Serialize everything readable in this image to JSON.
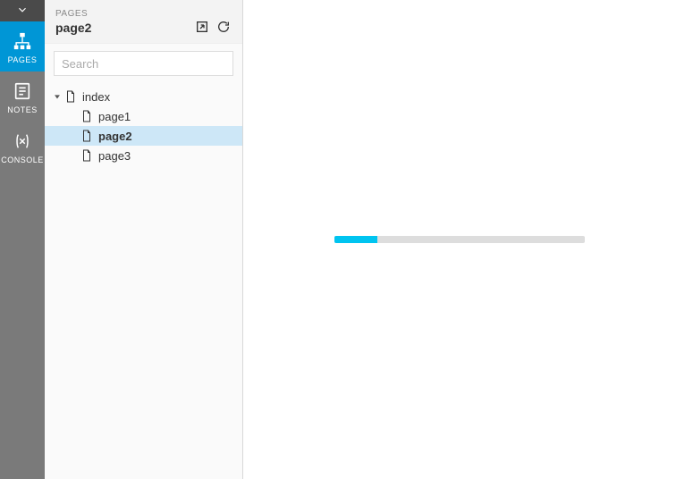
{
  "rail": {
    "items": [
      {
        "id": "pages",
        "label": "PAGES",
        "icon": "sitemap",
        "active": true
      },
      {
        "id": "notes",
        "label": "NOTES",
        "icon": "notes",
        "active": false
      },
      {
        "id": "console",
        "label": "CONSOLE",
        "icon": "variable",
        "active": false
      }
    ]
  },
  "sidebar": {
    "section_label": "PAGES",
    "title": "page2",
    "search_placeholder": "Search",
    "search_value": "",
    "tree": {
      "root": {
        "label": "index",
        "expanded": true
      },
      "children": [
        {
          "label": "page1",
          "selected": false
        },
        {
          "label": "page2",
          "selected": true
        },
        {
          "label": "page3",
          "selected": false
        }
      ]
    }
  },
  "main": {
    "progress_percent": 17
  },
  "colors": {
    "accent": "#0096d6",
    "progress": "#00c4f0",
    "rail_bg": "#7a7a7a",
    "rail_top": "#4a4a4a",
    "selected_row": "#cde7f7"
  }
}
